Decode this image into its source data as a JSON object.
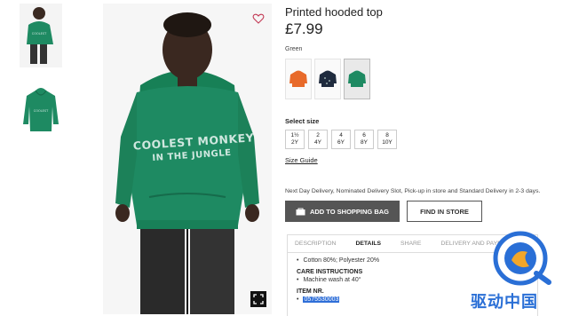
{
  "product": {
    "title": "Printed hooded top",
    "price": "£7.99",
    "color_label": "Green",
    "hoodie_print_line1": "COOLEST MONKEY",
    "hoodie_print_line2": "IN THE JUNGLE"
  },
  "thumbnails": [
    {
      "name": "model-photo"
    },
    {
      "name": "product-photo"
    }
  ],
  "swatches": [
    {
      "name": "orange",
      "color": "#e86a2a",
      "selected": false
    },
    {
      "name": "navy",
      "color": "#1f2b3e",
      "selected": false
    },
    {
      "name": "green",
      "color": "#1e8a62",
      "selected": true
    }
  ],
  "sizes": {
    "label": "Select size",
    "options": [
      {
        "line1": "1½",
        "line2": "2Y"
      },
      {
        "line1": "2",
        "line2": "4Y"
      },
      {
        "line1": "4",
        "line2": "6Y"
      },
      {
        "line1": "6",
        "line2": "8Y"
      },
      {
        "line1": "8",
        "line2": "10Y"
      }
    ],
    "guide": "Size Guide"
  },
  "delivery": "Next Day Delivery, Nominated Delivery Slot, Pick-up in store and Standard Delivery in 2-3 days.",
  "buttons": {
    "add_to_bag": "ADD TO SHOPPING BAG",
    "find_in_store": "FIND IN STORE"
  },
  "tabs": [
    "DESCRIPTION",
    "DETAILS",
    "SHARE",
    "DELIVERY AND PAYM"
  ],
  "details": {
    "composition": "Cotton 80%; Polyester 20%",
    "care_heading": "CARE INSTRUCTIONS",
    "care": "Machine wash at 40°",
    "item_heading": "ITEM NR.",
    "item_nr": "0575530003"
  },
  "watermark": {
    "text": "驱动中国"
  },
  "colors": {
    "hoodie_green": "#1e8a62",
    "button_dark": "#555555",
    "highlight_blue": "#2f6fd8",
    "watermark_blue": "#2a6fd6"
  }
}
